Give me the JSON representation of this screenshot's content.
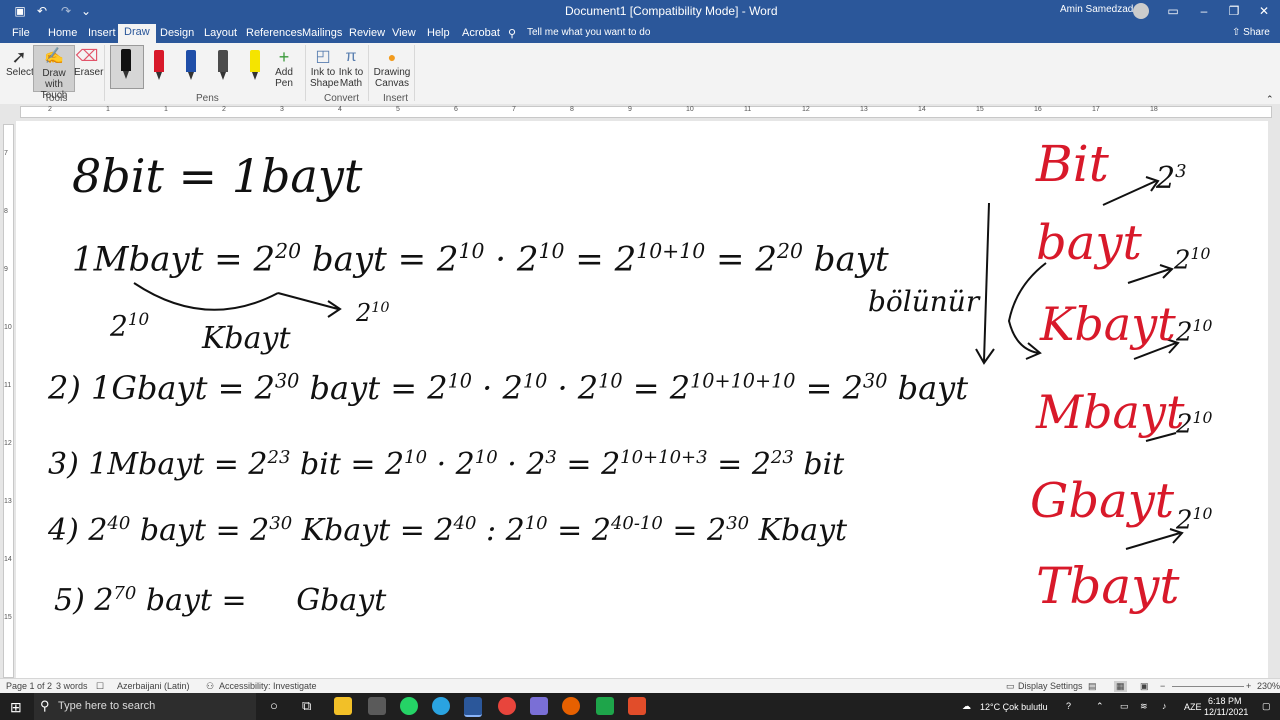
{
  "window": {
    "title": "Document1 [Compatibility Mode] - Word",
    "user": "Amin Samedzadeh",
    "tell_me": "Tell me what you want to do",
    "share": "Share"
  },
  "tabs": [
    "File",
    "Home",
    "Insert",
    "Draw",
    "Design",
    "Layout",
    "References",
    "Mailings",
    "Review",
    "View",
    "Help",
    "Acrobat"
  ],
  "active_tab": "Draw",
  "ribbon": {
    "tools": {
      "select": "Select",
      "draw_touch": "Draw with Touch",
      "eraser": "Eraser",
      "group": "Tools"
    },
    "pens": {
      "add_pen": "Add Pen",
      "group": "Pens",
      "colors": [
        "#111111",
        "#d8192a",
        "#1f4ea8",
        "#4b4b4b",
        "#f5e400"
      ]
    },
    "convert": {
      "ink_shape": "Ink to Shape",
      "ink_math": "Ink to Math",
      "group": "Convert"
    },
    "insert": {
      "canvas": "Drawing Canvas",
      "group": "Insert"
    }
  },
  "ruler_numbers": [
    "2",
    "1",
    "1",
    "2",
    "3",
    "4",
    "5",
    "6",
    "7",
    "8",
    "9",
    "10",
    "11",
    "12",
    "13",
    "14",
    "15",
    "16",
    "17",
    "18"
  ],
  "vruler_numbers": [
    "7",
    "8",
    "9",
    "10",
    "11",
    "12",
    "13",
    "14",
    "15"
  ],
  "ink_black": {
    "l1": "8bit = 1bayt",
    "l2a": "1Mbayt = 2",
    "l2a_sup": "20",
    "l2b": "bayt = 2",
    "l2b_sup": "10",
    "l2c": "· 2",
    "l2c_sup": "10",
    "l2d": "= 2",
    "l2d_sup": "10+10",
    "l2e": "= 2",
    "l2e_sup": "20",
    "l2f": "bayt",
    "a1": "2",
    "a1_sup": "10",
    "a2": "Kbayt",
    "a3": "2",
    "a3_sup": "10",
    "l3": "2) 1Gbayt = 2",
    "l3_sup": "30",
    "l3b": "bayt = 2",
    "l3b_sup": "10",
    "l3c": "· 2",
    "l3c_sup": "10",
    "l3d": "· 2",
    "l3d_sup": "10",
    "l3e": "= 2",
    "l3e_sup": "10+10+10",
    "l3f": "= 2",
    "l3f_sup": "30",
    "l3g": "bayt",
    "l4": "3) 1Mbayt = 2",
    "l4_sup": "23",
    "l4b": "bit = 2",
    "l4b_sup": "10",
    "l4c": "· 2",
    "l4c_sup": "10",
    "l4d": "· 2",
    "l4d_sup": "3",
    "l4e": "= 2",
    "l4e_sup": "10+10+3",
    "l4f": "= 2",
    "l4f_sup": "23",
    "l4g": "bit",
    "l5": "4) 2",
    "l5_sup": "40",
    "l5b": "bayt = 2",
    "l5b_sup": "30",
    "l5c": "Kbayt = 2",
    "l5c_sup": "40",
    "l5d": ": 2",
    "l5d_sup": "10",
    "l5e": "= 2",
    "l5e_sup": "40-10",
    "l5f": "= 2",
    "l5f_sup": "30",
    "l5g": "Kbayt",
    "l6": "5) 2",
    "l6_sup": "70",
    "l6b": "bayt =",
    "l6c": "Gbayt",
    "bolunur": "bölünür"
  },
  "ink_red": [
    "Bit",
    "bayt",
    "Kbayt",
    "Mbayt",
    "Gbayt",
    "Tbayt"
  ],
  "ink_right": [
    {
      "b": "2",
      "s": "3"
    },
    {
      "b": "2",
      "s": "10"
    },
    {
      "b": "2",
      "s": "10"
    },
    {
      "b": "2",
      "s": "10"
    },
    {
      "b": "2",
      "s": "10"
    }
  ],
  "status": {
    "page": "Page 1 of 2",
    "words": "3 words",
    "language": "Azerbaijani (Latin)",
    "accessibility": "Accessibility: Investigate",
    "display": "Display Settings",
    "zoom": "230%"
  },
  "taskbar": {
    "search": "Type here to search",
    "weather": "12°C  Çok bulutlu",
    "lang": "AZE",
    "time": "6:18 PM",
    "date": "12/11/2021"
  }
}
